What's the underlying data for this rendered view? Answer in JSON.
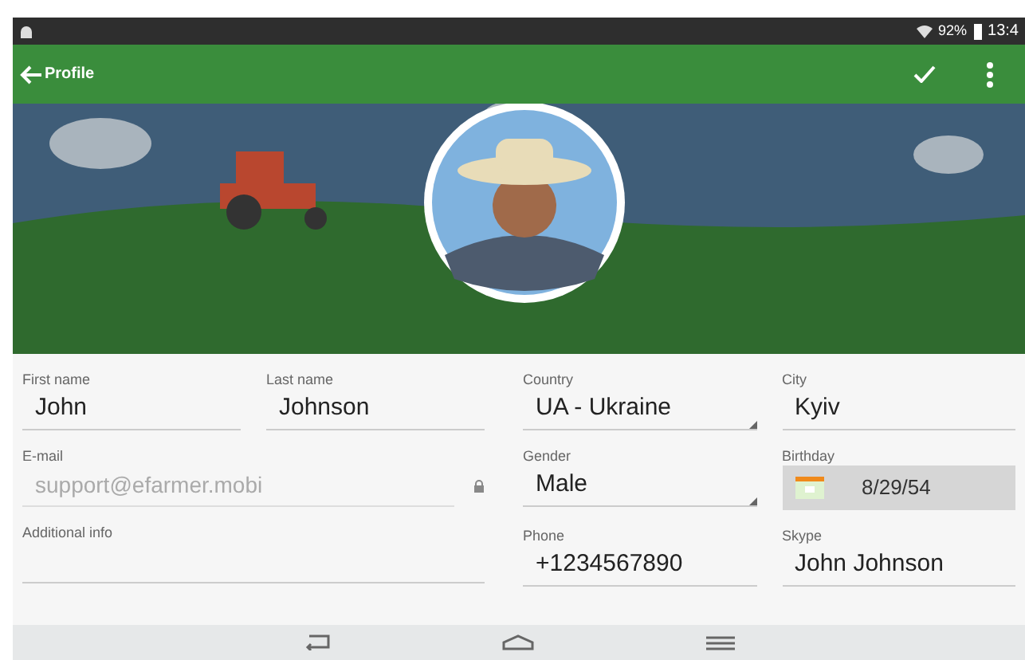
{
  "status_bar": {
    "battery": "92%",
    "time": "13:4"
  },
  "toolbar": {
    "title": "Profile"
  },
  "form": {
    "left": [
      [
        {
          "kind": "text",
          "label": "First name",
          "value": "John"
        },
        {
          "kind": "text",
          "label": "Last name",
          "value": "Johnson"
        }
      ],
      [
        {
          "kind": "locked",
          "label": "E-mail",
          "value": "support@efarmer.mobi"
        }
      ],
      [
        {
          "kind": "text",
          "label": "Additional info"
        }
      ]
    ],
    "right": [
      [
        {
          "kind": "dropdown",
          "label": "Country",
          "value": "UA - Ukraine"
        },
        {
          "kind": "text",
          "label": "City",
          "value": "Kyiv"
        }
      ],
      [
        {
          "kind": "dropdown",
          "label": "Gender",
          "value": "Male"
        },
        {
          "kind": "date",
          "label": "Birthday",
          "value": "8/29/54"
        }
      ],
      [
        {
          "kind": "text",
          "label": "Phone",
          "value": "+1234567890"
        },
        {
          "kind": "text",
          "label": "Skype",
          "value": "John Johnson"
        }
      ]
    ]
  }
}
